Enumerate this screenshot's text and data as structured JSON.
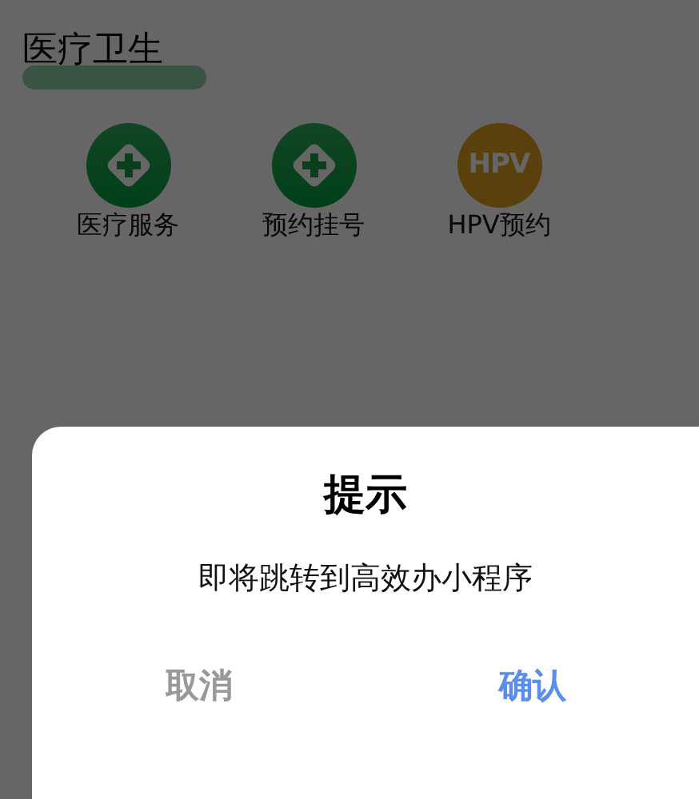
{
  "section": {
    "title": "医疗卫生"
  },
  "services": [
    {
      "label": "医疗服务",
      "kind": "cross"
    },
    {
      "label": "预约挂号",
      "kind": "cross"
    },
    {
      "label": "HPV预约",
      "kind": "text",
      "icon_text": "HPV"
    }
  ],
  "dialog": {
    "title": "提示",
    "message": "即将跳转到高效办小程序",
    "buttons": [
      {
        "label": "取消",
        "kind": "cancel"
      },
      {
        "label": "确认",
        "kind": "confirm"
      }
    ]
  }
}
